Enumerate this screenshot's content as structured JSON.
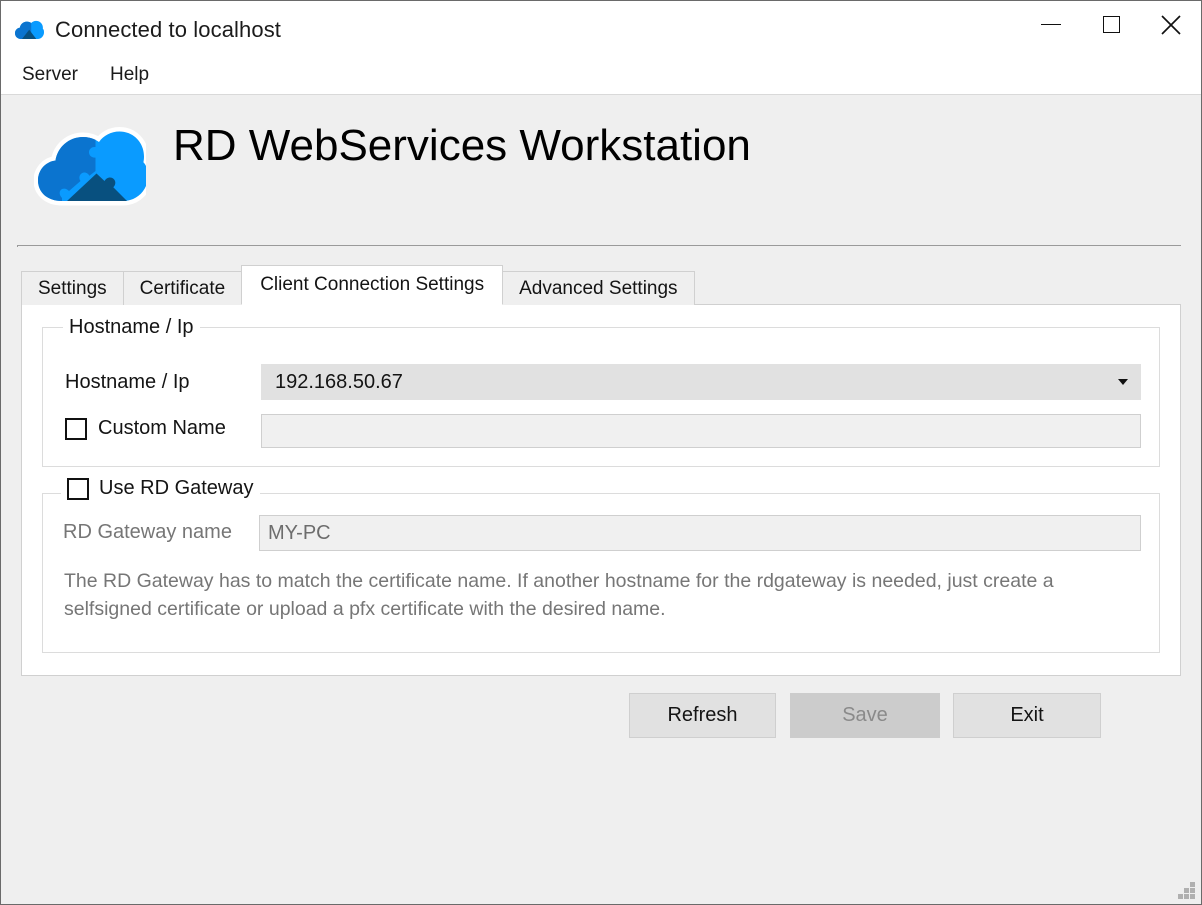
{
  "window": {
    "title": "Connected to localhost",
    "icon": "cloud-icon",
    "controls": {
      "minimize": "minimize-icon",
      "maximize": "maximize-icon",
      "close": "close-icon"
    }
  },
  "menu": {
    "items": [
      {
        "label": "Server"
      },
      {
        "label": "Help"
      }
    ]
  },
  "brand": {
    "logo": "cloud-puzzle-logo",
    "title": "RD WebServices Workstation",
    "colors": {
      "light_blue": "#0a9bff",
      "mid_blue": "#0b74cf",
      "dark_blue": "#08507f"
    }
  },
  "tabs": [
    {
      "label": "Settings",
      "selected": false
    },
    {
      "label": "Certificate",
      "selected": false
    },
    {
      "label": "Client Connection Settings",
      "selected": true
    },
    {
      "label": "Advanced Settings",
      "selected": false
    }
  ],
  "hostname_group": {
    "title": "Hostname / Ip",
    "hostname_label": "Hostname / Ip",
    "hostname_value": "192.168.50.67",
    "hostname_dropdown_icon": "chevron-down-icon",
    "custom_name_label": "Custom Name",
    "custom_name_checked": false,
    "custom_name_value": "",
    "custom_name_placeholder": ""
  },
  "gateway_group": {
    "title": "Use RD Gateway",
    "use_gateway_checked": false,
    "name_label": "RD Gateway name",
    "name_value": "MY-PC",
    "hint": "The RD Gateway has to match the certificate name. If another hostname for the rdgateway is needed, just create a selfsigned certificate or upload a pfx certificate with the desired name."
  },
  "footer": {
    "refresh_label": "Refresh",
    "save_label": "Save",
    "save_disabled": true,
    "exit_label": "Exit"
  },
  "grip": "resize-grip-icon"
}
